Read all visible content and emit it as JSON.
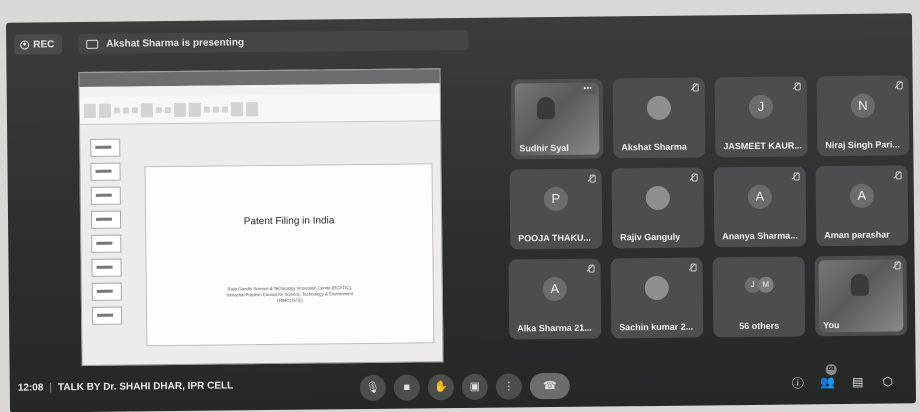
{
  "top_bar": {
    "rec_label": "REC",
    "presenting_text": "Akshat Sharma is presenting"
  },
  "shared_screen": {
    "slide_title": "Patent Filing in India",
    "slide_subtitle_line1": "Rajiv Gandhi Science & Technology Innovation Centre (RGSTIC),",
    "slide_subtitle_line2": "Himachal Pradesh Council for Science, Technology & Environment",
    "slide_subtitle_line3": "(HIMCOSTE)"
  },
  "participants": [
    {
      "name": "Sudhir Syal",
      "type": "video"
    },
    {
      "name": "Akshat Sharma",
      "type": "photo"
    },
    {
      "name": "JASMEET KAUR...",
      "initial": "J"
    },
    {
      "name": "Niraj Singh Pari...",
      "initial": "N"
    },
    {
      "name": "POOJA THAKU...",
      "initial": "P"
    },
    {
      "name": "Rajiv Ganguly",
      "type": "photo"
    },
    {
      "name": "Ananya Sharma...",
      "initial": "A"
    },
    {
      "name": "Aman parashar",
      "initial": "A"
    },
    {
      "name": "Alka Sharma 21...",
      "initial": "A"
    },
    {
      "name": "Sachin kumar 2...",
      "type": "photo"
    },
    {
      "name": "56 others",
      "initials": [
        "J",
        "M"
      ]
    },
    {
      "name": "You",
      "type": "video"
    }
  ],
  "bottom_bar": {
    "time": "12:08",
    "meeting_title": "TALK BY Dr. SHAHI DHAR, IPR CELL",
    "people_count": "68"
  },
  "colors": {
    "background": "#2c2e2d",
    "tile": "#4c4e4d",
    "control": "#4c4e4d"
  }
}
